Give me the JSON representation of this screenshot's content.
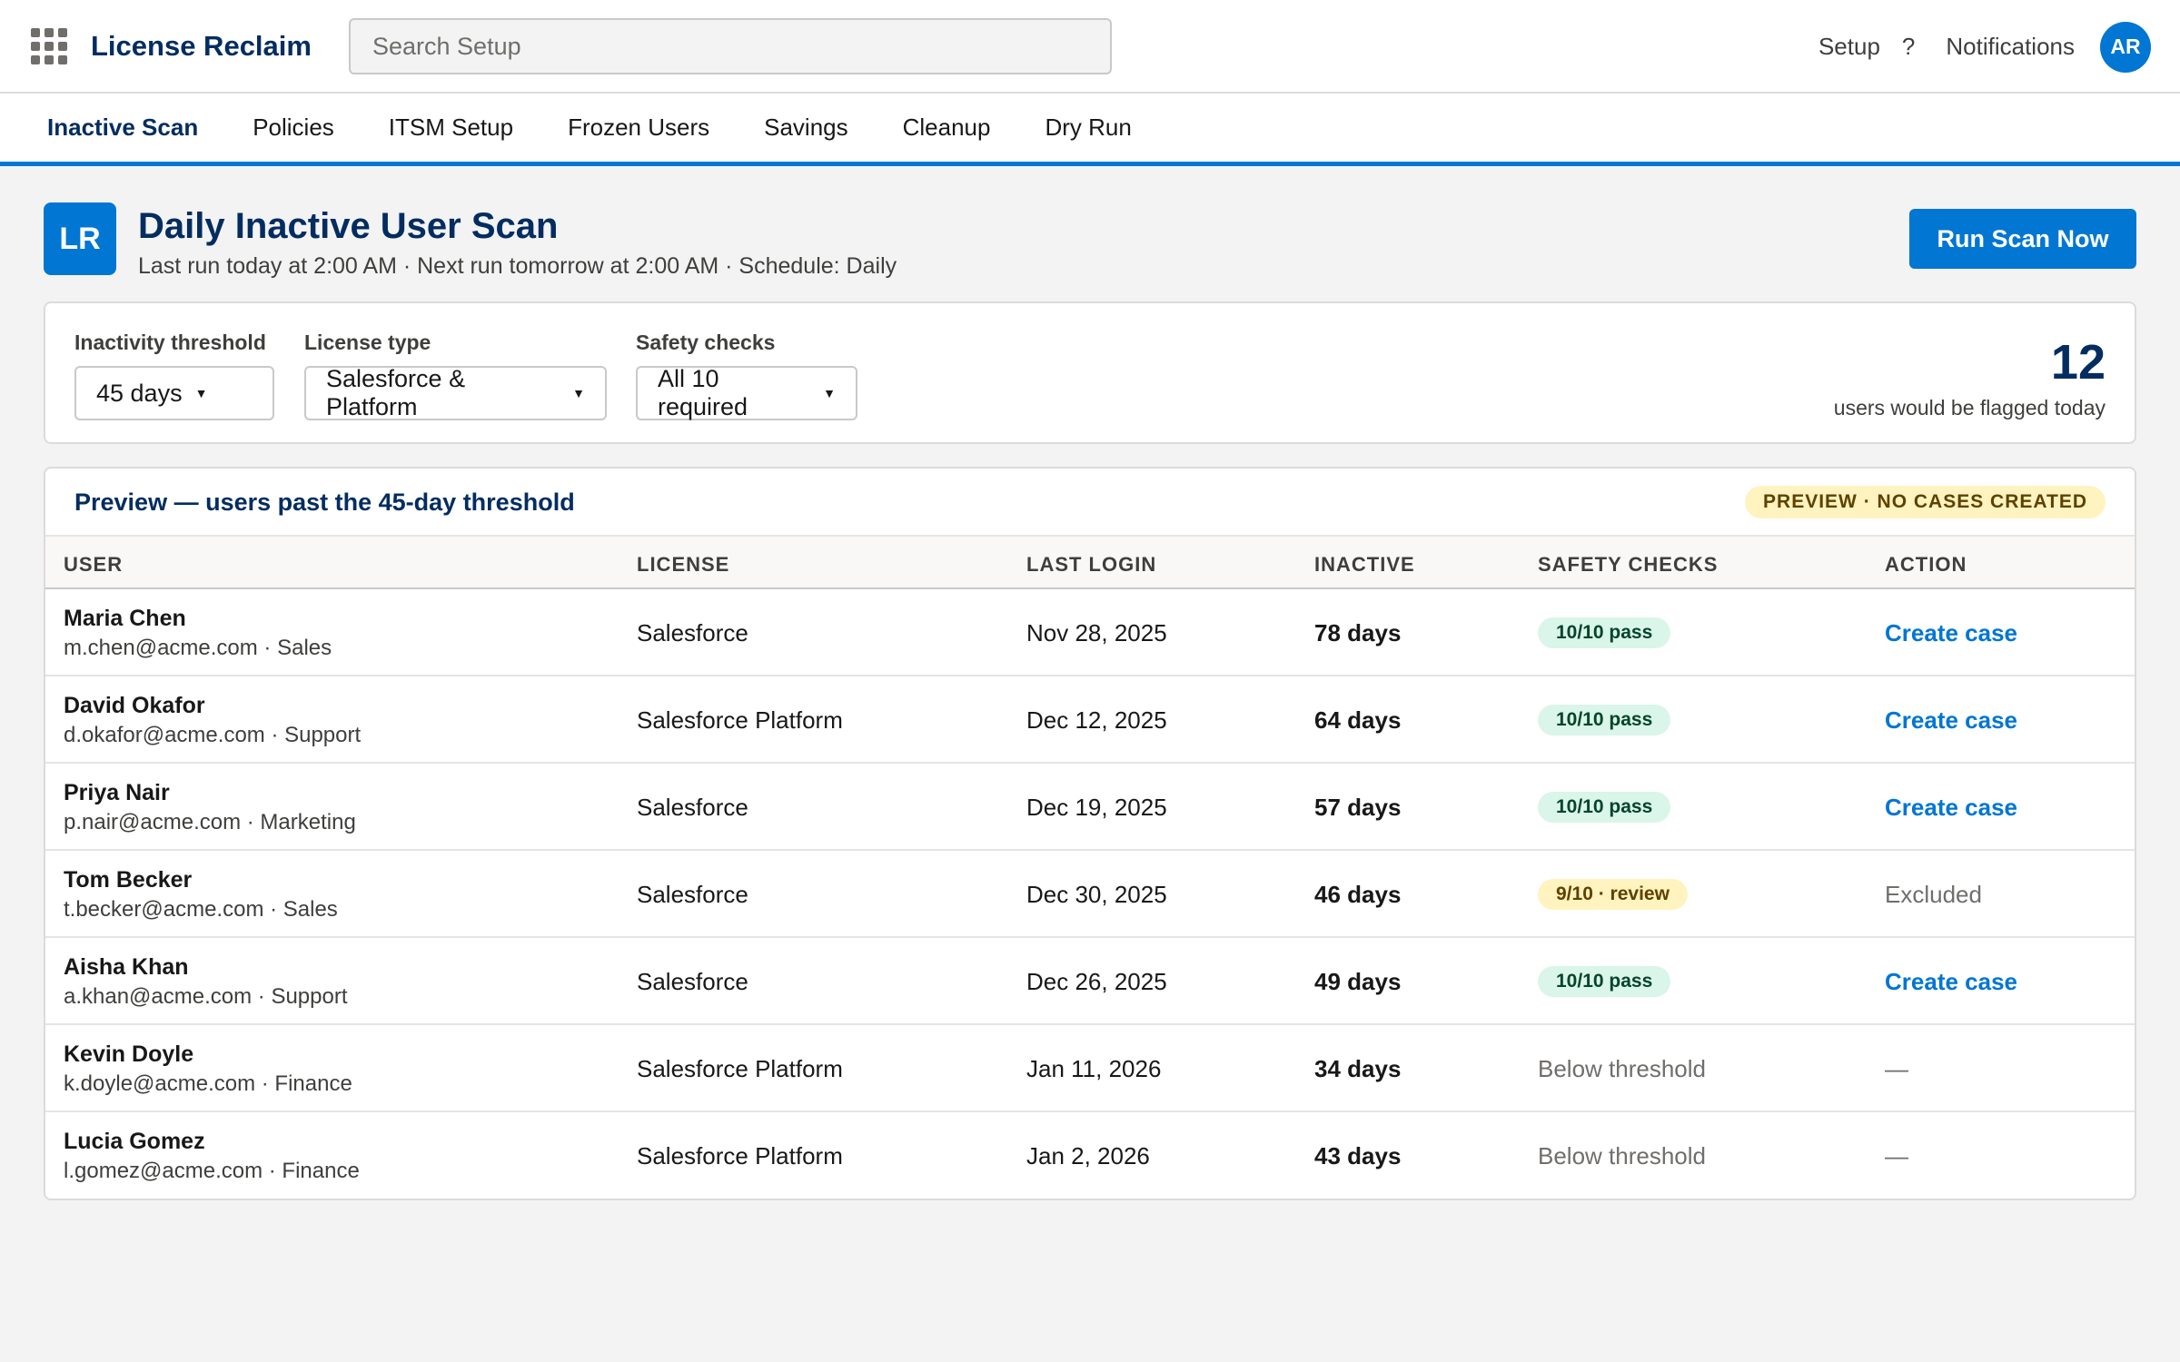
{
  "app": {
    "name": "License Reclaim"
  },
  "header": {
    "search_placeholder": "Search Setup",
    "setup_label": "Setup",
    "help_label": "?",
    "notifications_label": "Notifications",
    "avatar_initials": "AR"
  },
  "tabs": [
    {
      "label": "Inactive Scan",
      "active": true
    },
    {
      "label": "Policies"
    },
    {
      "label": "ITSM Setup"
    },
    {
      "label": "Frozen Users"
    },
    {
      "label": "Savings"
    },
    {
      "label": "Cleanup"
    },
    {
      "label": "Dry Run"
    }
  ],
  "page": {
    "badge": "LR",
    "title": "Daily Inactive User Scan",
    "subtitle": "Last run today at 2:00 AM · Next run tomorrow at 2:00 AM · Schedule: Daily",
    "run_button": "Run Scan Now"
  },
  "filters": {
    "threshold": {
      "label": "Inactivity threshold",
      "value": "45 days"
    },
    "license": {
      "label": "License type",
      "value": "Salesforce & Platform"
    },
    "safety": {
      "label": "Safety checks",
      "value": "All 10 required"
    },
    "flagged_count": "12",
    "flagged_label": "users would be flagged today"
  },
  "table": {
    "title": "Preview — users past the 45-day threshold",
    "badge": "PREVIEW · NO CASES CREATED",
    "columns": [
      "USER",
      "LICENSE",
      "LAST LOGIN",
      "INACTIVE",
      "SAFETY CHECKS",
      "ACTION"
    ],
    "rows": [
      {
        "name": "Maria Chen",
        "sub": "m.chen@acme.com · Sales",
        "license": "Salesforce",
        "last_login": "Nov 28, 2025",
        "inactive": "78 days",
        "safety": "10/10 pass",
        "safety_type": "pass",
        "action": "Create case",
        "action_type": "link"
      },
      {
        "name": "David Okafor",
        "sub": "d.okafor@acme.com · Support",
        "license": "Salesforce Platform",
        "last_login": "Dec 12, 2025",
        "inactive": "64 days",
        "safety": "10/10 pass",
        "safety_type": "pass",
        "action": "Create case",
        "action_type": "link"
      },
      {
        "name": "Priya Nair",
        "sub": "p.nair@acme.com · Marketing",
        "license": "Salesforce",
        "last_login": "Dec 19, 2025",
        "inactive": "57 days",
        "safety": "10/10 pass",
        "safety_type": "pass",
        "action": "Create case",
        "action_type": "link"
      },
      {
        "name": "Tom Becker",
        "sub": "t.becker@acme.com · Sales",
        "license": "Salesforce",
        "last_login": "Dec 30, 2025",
        "inactive": "46 days",
        "safety": "9/10 · review",
        "safety_type": "review",
        "action": "Excluded",
        "action_type": "muted"
      },
      {
        "name": "Aisha Khan",
        "sub": "a.khan@acme.com · Support",
        "license": "Salesforce",
        "last_login": "Dec 26, 2025",
        "inactive": "49 days",
        "safety": "10/10 pass",
        "safety_type": "pass",
        "action": "Create case",
        "action_type": "link"
      },
      {
        "name": "Kevin Doyle",
        "sub": "k.doyle@acme.com · Finance",
        "license": "Salesforce Platform",
        "last_login": "Jan 11, 2026",
        "inactive": "34 days",
        "safety": "Below threshold",
        "safety_type": "muted",
        "action": "—",
        "action_type": "muted"
      },
      {
        "name": "Lucia Gomez",
        "sub": "l.gomez@acme.com · Finance",
        "license": "Salesforce Platform",
        "last_login": "Jan 2, 2026",
        "inactive": "43 days",
        "safety": "Below threshold",
        "safety_type": "muted",
        "action": "—",
        "action_type": "muted"
      }
    ]
  },
  "colors": {
    "brand": "#0176d3",
    "navy": "#032d60",
    "pass_bg": "#daf5e9",
    "review_bg": "#fff3bf"
  }
}
